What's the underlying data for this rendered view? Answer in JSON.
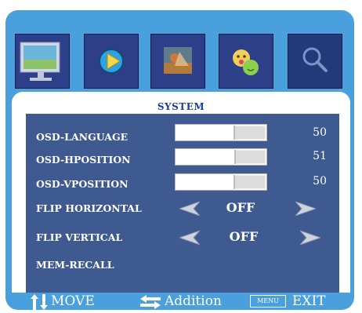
{
  "tabs": [
    {
      "name": "picture-tab",
      "icon": "monitor-icon"
    },
    {
      "name": "play-tab",
      "icon": "play-icon"
    },
    {
      "name": "image-tab",
      "icon": "photo-icon"
    },
    {
      "name": "face-tab",
      "icon": "faces-icon"
    },
    {
      "name": "system-tab",
      "icon": "magnifier-icon"
    }
  ],
  "section_title": "SYSTEM",
  "items": {
    "osd_language": {
      "label": "OSD-LANGUAGE",
      "value": "50",
      "level": 50
    },
    "osd_hposition": {
      "label": "OSD-HPOSITION",
      "value": "51",
      "level": 51
    },
    "osd_vposition": {
      "label": "OSD-VPOSITION",
      "value": "50",
      "level": 50
    },
    "flip_horizontal": {
      "label": "FLIP HORIZONTAL",
      "value": "OFF"
    },
    "flip_vertical": {
      "label": "FLIP VERTICAL",
      "value": "OFF"
    },
    "mem_recall": {
      "label": "MEM-RECALL"
    }
  },
  "footer": {
    "move": "MOVE",
    "addition": "Addition",
    "menu": "MENU",
    "exit": "EXIT"
  },
  "colors": {
    "frame": "#4aa0dc",
    "menu_bg": "#3e5a91",
    "tab_bg": "#2c3f88",
    "title": "#1a3e9c"
  }
}
